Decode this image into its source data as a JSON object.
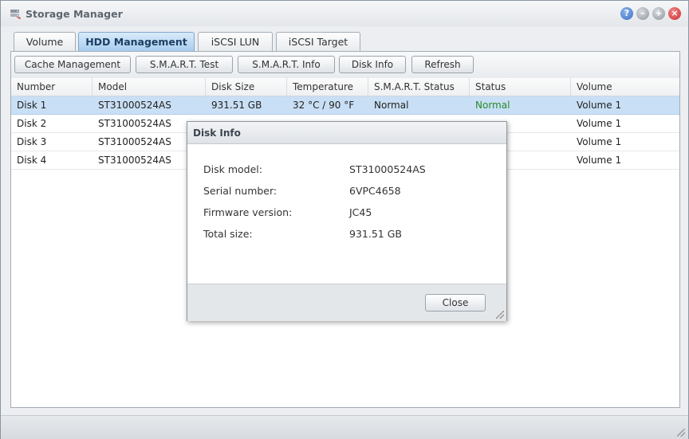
{
  "window": {
    "title": "Storage Manager",
    "controls": [
      "help-icon",
      "minimize-icon",
      "maximize-icon",
      "close-icon"
    ]
  },
  "tabs": [
    {
      "label": "Volume",
      "active": false
    },
    {
      "label": "HDD Management",
      "active": true
    },
    {
      "label": "iSCSI LUN",
      "active": false
    },
    {
      "label": "iSCSI Target",
      "active": false
    }
  ],
  "toolbar": {
    "buttons": [
      "Cache Management",
      "S.M.A.R.T. Test",
      "S.M.A.R.T. Info",
      "Disk Info",
      "Refresh"
    ]
  },
  "table": {
    "columns": [
      "Number",
      "Model",
      "Disk Size",
      "Temperature",
      "S.M.A.R.T. Status",
      "Status",
      "Volume"
    ],
    "rows": [
      [
        "Disk 1",
        "ST31000524AS",
        "931.51 GB",
        "32 °C / 90 °F",
        "Normal",
        "Normal",
        "Volume 1"
      ],
      [
        "Disk 2",
        "ST31000524AS",
        "",
        "",
        "",
        "",
        "Volume 1"
      ],
      [
        "Disk 3",
        "ST31000524AS",
        "",
        "",
        "",
        "",
        "Volume 1"
      ],
      [
        "Disk 4",
        "ST31000524AS",
        "",
        "",
        "",
        "",
        "Volume 1"
      ]
    ],
    "selected_row": 0
  },
  "dialog": {
    "title": "Disk Info",
    "fields": [
      {
        "label": "Disk model:",
        "value": "ST31000524AS"
      },
      {
        "label": "Serial number:",
        "value": "6VPC4658"
      },
      {
        "label": "Firmware version:",
        "value": "JC45"
      },
      {
        "label": "Total size:",
        "value": "931.51 GB"
      }
    ],
    "close_label": "Close"
  },
  "colors": {
    "accent": "#a7cdef",
    "selection": "#c9dff5",
    "status_ok": "#2a8a2a"
  }
}
